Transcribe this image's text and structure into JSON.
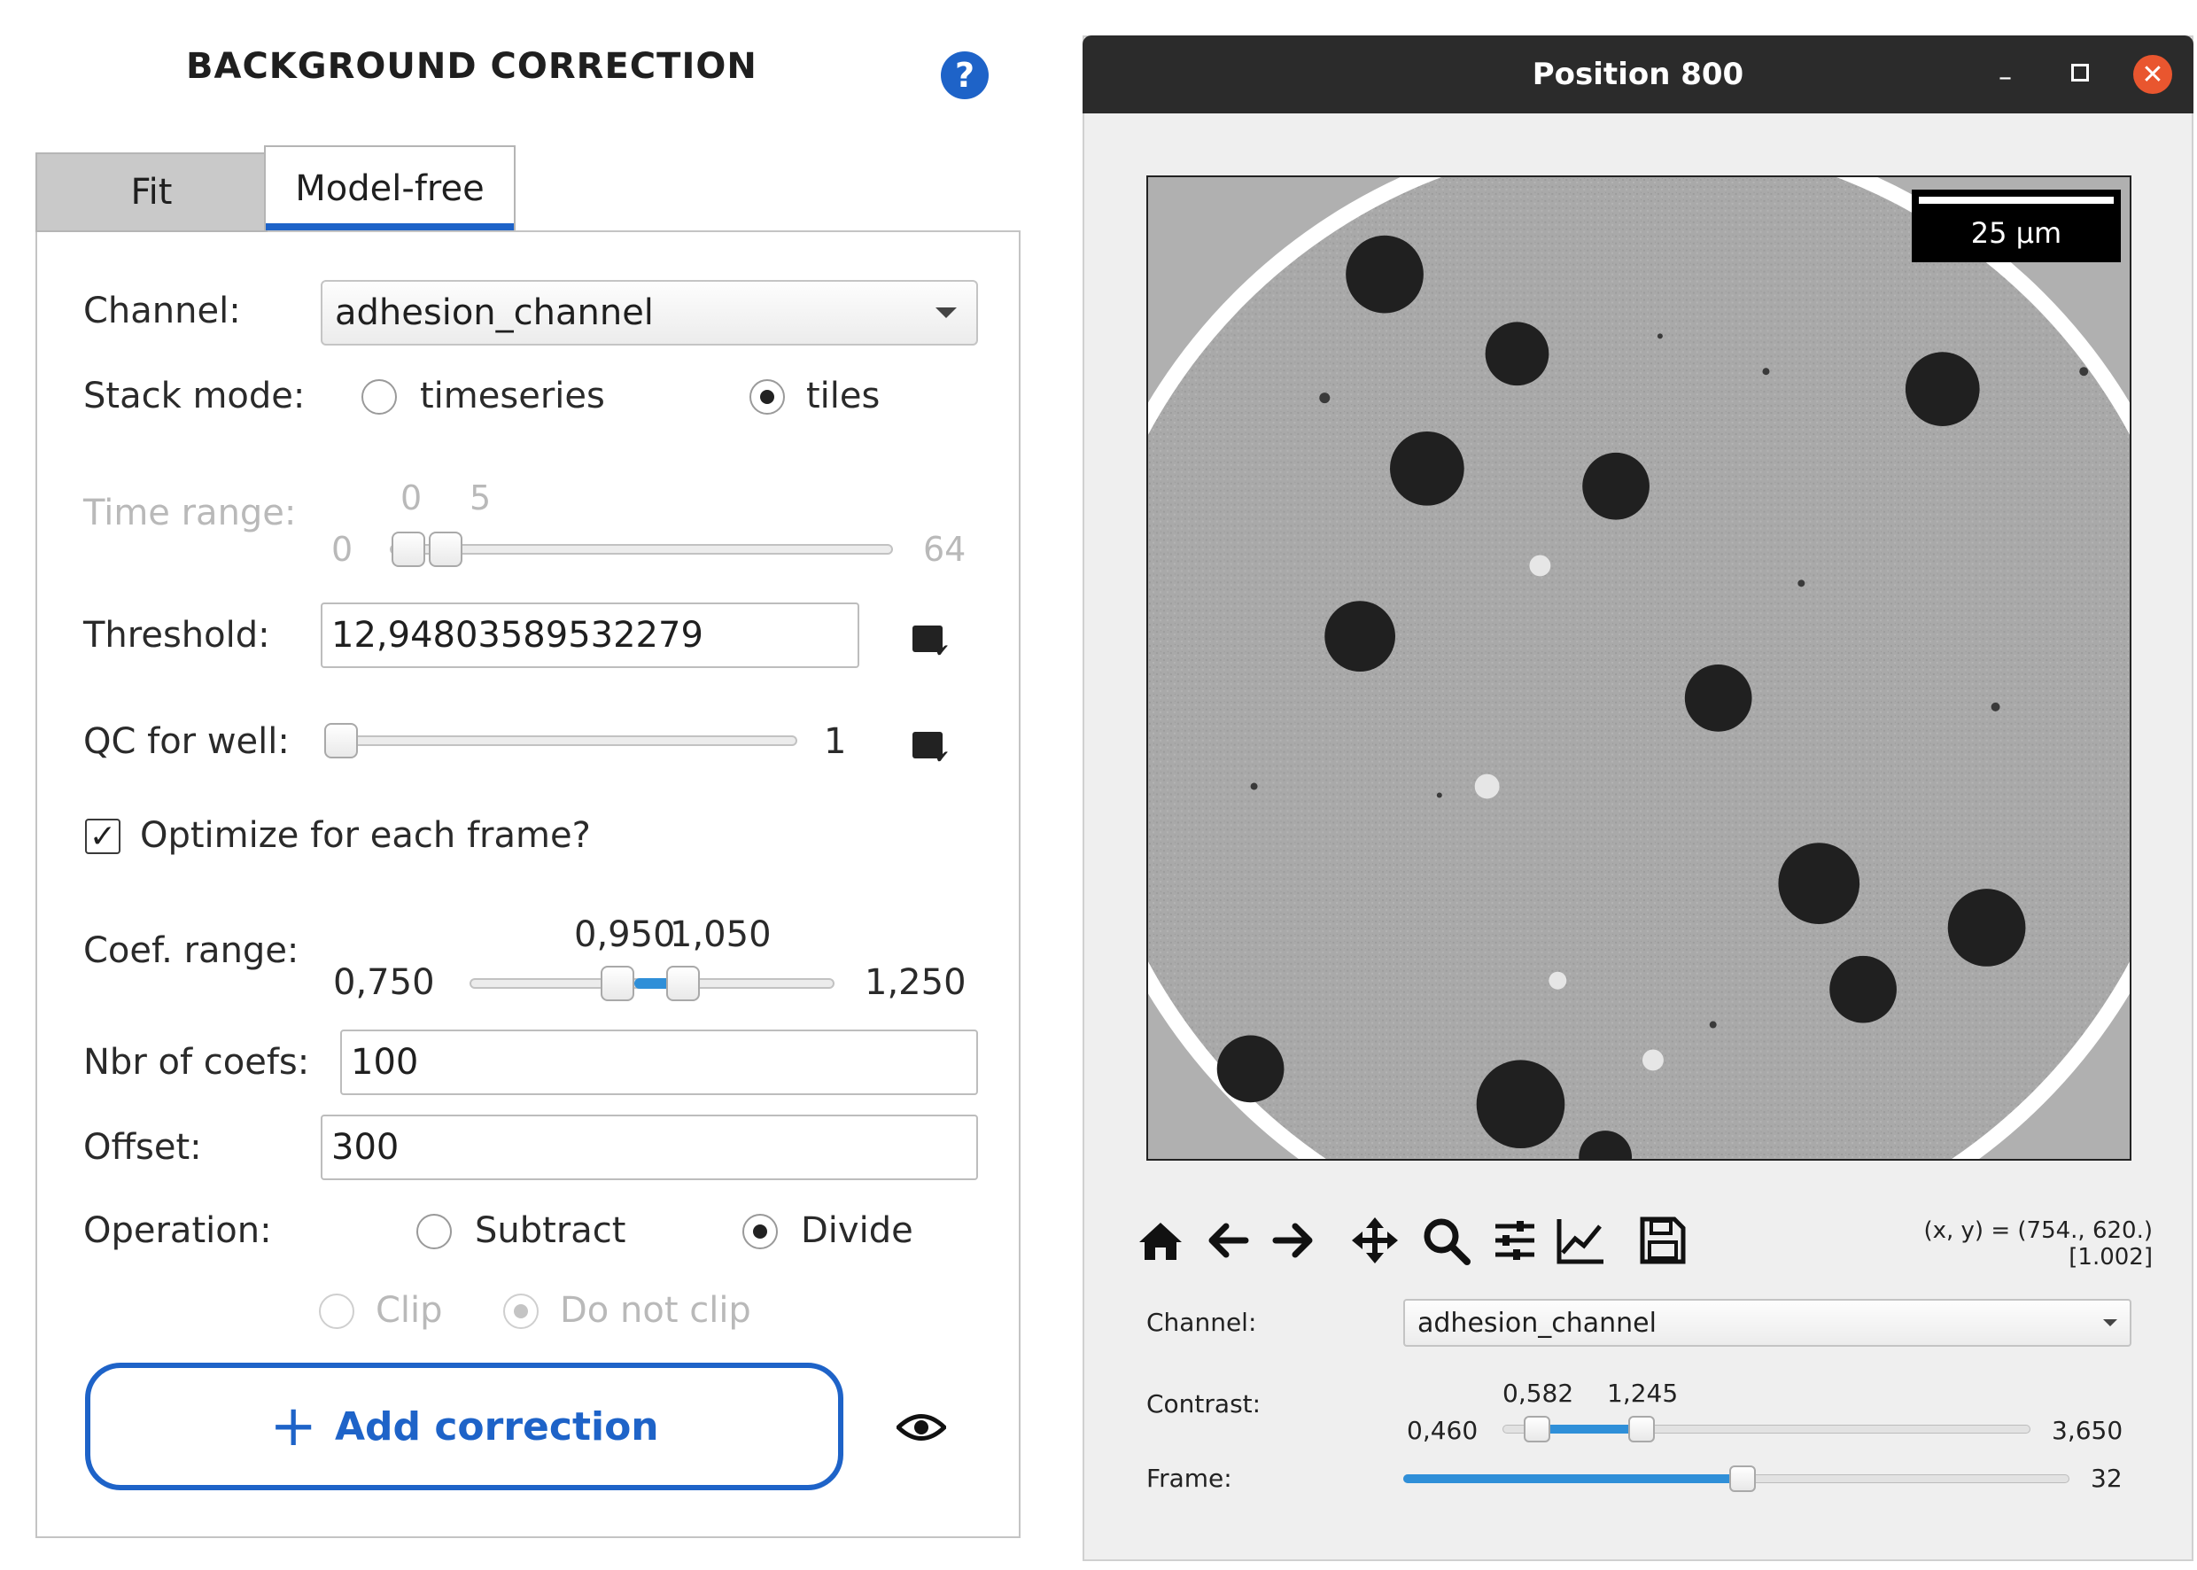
{
  "panel": {
    "title": "BACKGROUND CORRECTION",
    "help_icon_glyph": "?",
    "tabs": [
      {
        "label": "Fit",
        "active": false
      },
      {
        "label": "Model-free",
        "active": true
      }
    ],
    "channel": {
      "label": "Channel:",
      "value": "adhesion_channel"
    },
    "stack_mode": {
      "label": "Stack mode:",
      "options": [
        "timeseries",
        "tiles"
      ],
      "selected": "tiles"
    },
    "time_range": {
      "label": "Time range:",
      "min": "0",
      "max": "64",
      "low": "0",
      "high": "5"
    },
    "threshold": {
      "label": "Threshold:",
      "value": "12,94803589532279"
    },
    "qc_for_well": {
      "label": "QC for well:",
      "value": "1"
    },
    "optimize": {
      "label": "Optimize for each frame?",
      "checked": true,
      "check_glyph": "✓"
    },
    "coef_range": {
      "label": "Coef. range:",
      "min": "0,750",
      "max": "1,250",
      "low": "0,950",
      "high": "1,050"
    },
    "nbr_of_coefs": {
      "label": "Nbr of coefs:",
      "value": "100"
    },
    "offset": {
      "label": "Offset:",
      "value": "300"
    },
    "operation": {
      "label": "Operation:",
      "options": [
        "Subtract",
        "Divide"
      ],
      "selected": "Divide"
    },
    "clip": {
      "options": [
        "Clip",
        "Do not clip"
      ],
      "selected": "Do not clip"
    },
    "add_button": {
      "plus": "+",
      "label": "Add correction"
    },
    "accent_color": "#1e63c8"
  },
  "viewer": {
    "window_title": "Position 800",
    "controls": {
      "minimize": "–",
      "close": "✕"
    },
    "scalebar_label": "25 µm",
    "toolbar": [
      "home-icon",
      "back-arrow-icon",
      "forward-arrow-icon",
      "pan-icon",
      "zoom-icon",
      "configure-subplots-icon",
      "edit-axis-icon",
      "save-icon"
    ],
    "coords_line1": "(x, y) = (754., 620.)",
    "coords_line2": "[1.002]",
    "channel": {
      "label": "Channel:",
      "value": "adhesion_channel"
    },
    "contrast": {
      "label": "Contrast:",
      "min": "0,460",
      "max": "3,650",
      "low": "0,582",
      "high": "1,245"
    },
    "frame": {
      "label": "Frame:",
      "value": "32",
      "max": 64
    }
  }
}
